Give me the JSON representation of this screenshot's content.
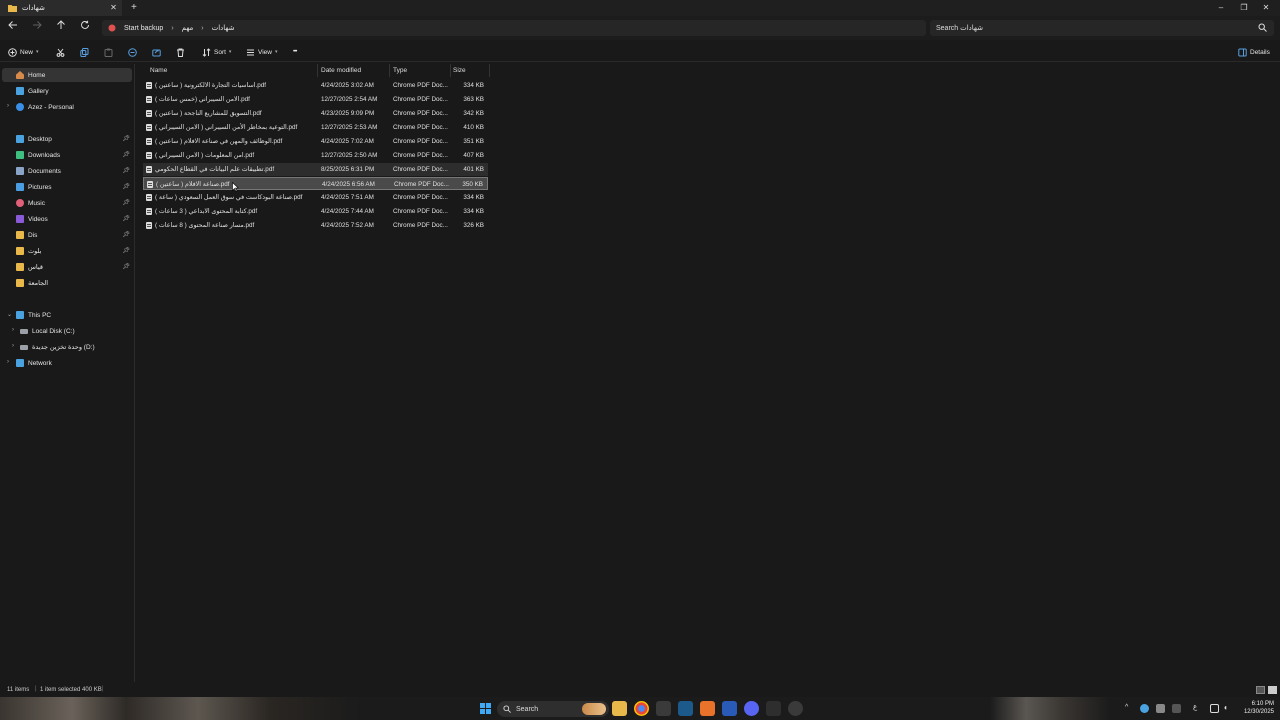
{
  "window": {
    "tab_title": "شهادات",
    "close": "✕",
    "new_tab": "+",
    "minimize": "–",
    "restore": "❐",
    "close_window": "✕"
  },
  "address": {
    "crumbs": [
      "Start backup",
      "مهم",
      "شهادات"
    ],
    "search_placeholder": "Search شهادات"
  },
  "commands": {
    "new": "New",
    "sort": "Sort",
    "view": "View",
    "more": "•••",
    "details": "Details"
  },
  "sidebar": {
    "items": [
      {
        "label": "Home",
        "icon": "home-icon",
        "color": "#d88a4a"
      },
      {
        "label": "Gallery",
        "icon": "gallery-icon",
        "color": "#4aa3e0"
      },
      {
        "label": "Azez - Personal",
        "icon": "cloud-icon",
        "color": "#3a8ee6"
      },
      {
        "label": "Desktop",
        "icon": "desktop-icon",
        "color": "#4aa3e0"
      },
      {
        "label": "Downloads",
        "icon": "download-icon",
        "color": "#3fbf7f"
      },
      {
        "label": "Documents",
        "icon": "document-icon",
        "color": "#8aa4c8"
      },
      {
        "label": "Pictures",
        "icon": "pictures-icon",
        "color": "#4a9de0"
      },
      {
        "label": "Music",
        "icon": "music-icon",
        "color": "#e0607a"
      },
      {
        "label": "Videos",
        "icon": "videos-icon",
        "color": "#8a5ad8"
      },
      {
        "label": "Dis",
        "icon": "folder-icon",
        "color": "#e8b84a"
      },
      {
        "label": "بلوت",
        "icon": "folder-icon",
        "color": "#e8b84a"
      },
      {
        "label": "قياس",
        "icon": "folder-icon",
        "color": "#e8b84a"
      },
      {
        "label": "الجامعة",
        "icon": "folder-icon",
        "color": "#e8b84a"
      },
      {
        "label": "This PC",
        "icon": "pc-icon",
        "color": "#4aa3e0"
      },
      {
        "label": "Local Disk (C:)",
        "icon": "disk-icon",
        "color": "#9aa0a6"
      },
      {
        "label": "وحدة تخزين جديدة (D:)",
        "icon": "disk-icon",
        "color": "#9aa0a6"
      },
      {
        "label": "Network",
        "icon": "network-icon",
        "color": "#4aa3e0"
      }
    ]
  },
  "columns": {
    "name": "Name",
    "date": "Date modified",
    "type": "Type",
    "size": "Size"
  },
  "files": [
    {
      "name": "اساسيات التجارة الالكترونية ( ساعتين ).pdf",
      "date": "4/24/2025 3:02 AM",
      "type": "Chrome PDF Doc...",
      "size": "334 KB"
    },
    {
      "name": "الامن السيبراني (خمس ساعات ).pdf",
      "date": "12/27/2025 2:54 AM",
      "type": "Chrome PDF Doc...",
      "size": "363 KB"
    },
    {
      "name": "التسويق للمشاريع الناجحة ( ساعتين ).pdf",
      "date": "4/23/2025 9:09 PM",
      "type": "Chrome PDF Doc...",
      "size": "342 KB"
    },
    {
      "name": "التوعية بمخاطر الأمن السيبراني ( الامن السيبراني ).pdf",
      "date": "12/27/2025 2:53 AM",
      "type": "Chrome PDF Doc...",
      "size": "410 KB"
    },
    {
      "name": "الوظائف والمهن في صناعة الافلام ( ساعتين ).pdf",
      "date": "4/24/2025 7:02 AM",
      "type": "Chrome PDF Doc...",
      "size": "351 KB"
    },
    {
      "name": "امن المعلومات ( الامن السيبراني ).pdf",
      "date": "12/27/2025 2:50 AM",
      "type": "Chrome PDF Doc...",
      "size": "407 KB"
    },
    {
      "name": "تطبيقات علم البيانات في القطاع الحكومي.pdf",
      "date": "8/25/2025 6:31 PM",
      "type": "Chrome PDF Doc...",
      "size": "401 KB"
    },
    {
      "name": "صناعة الافلام ( ساعتين ).pdf",
      "date": "4/24/2025 6:56 AM",
      "type": "Chrome PDF Doc...",
      "size": "350 KB"
    },
    {
      "name": "صناعة البودكاست في سوق العمل السعودي ( ساعة ).pdf",
      "date": "4/24/2025 7:51 AM",
      "type": "Chrome PDF Doc...",
      "size": "334 KB"
    },
    {
      "name": "كتابة المحتوى الابداعي ( 3 ساعات ).pdf",
      "date": "4/24/2025 7:44 AM",
      "type": "Chrome PDF Doc...",
      "size": "334 KB"
    },
    {
      "name": "مسار صناعة المحتوى ( 8 ساعات ).pdf",
      "date": "4/24/2025 7:52 AM",
      "type": "Chrome PDF Doc...",
      "size": "326 KB"
    }
  ],
  "status": {
    "items": "11 items",
    "selected": "1 item selected  400 KB"
  },
  "taskbar": {
    "search": "Search",
    "time": "6:10 PM",
    "date": "12/30/2025",
    "lang": "ع"
  }
}
